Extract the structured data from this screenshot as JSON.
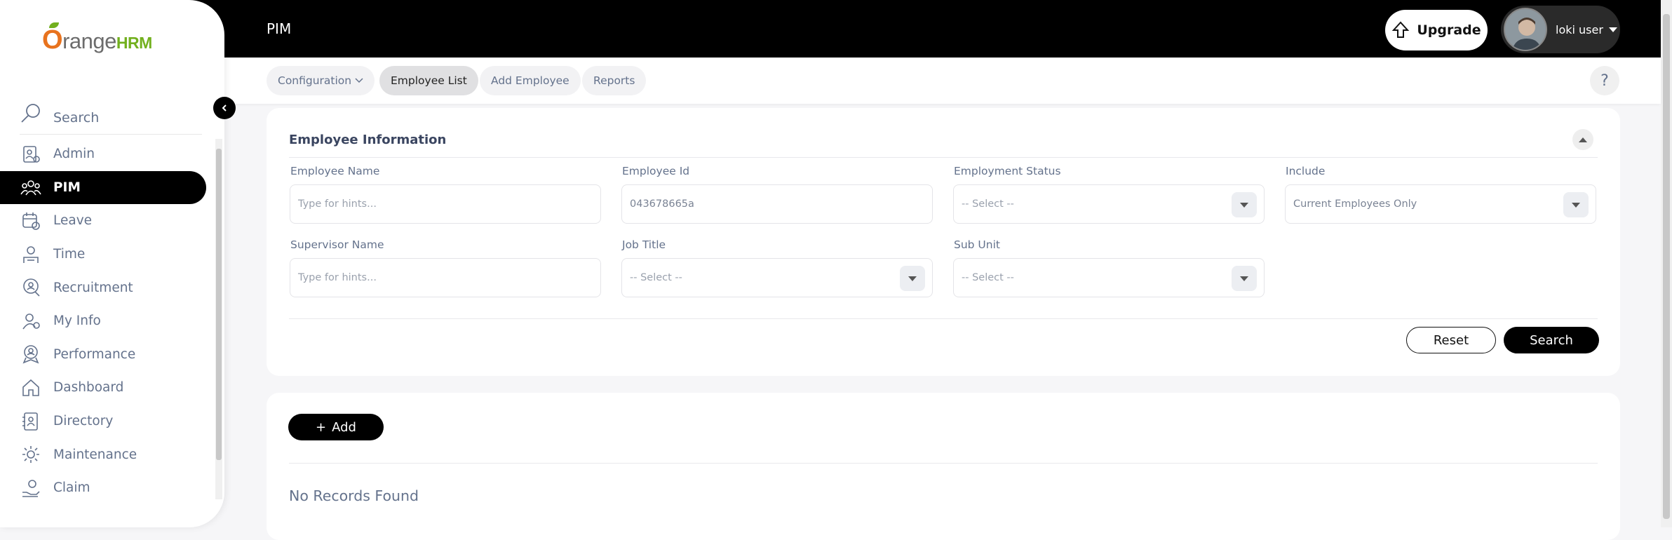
{
  "topbar": {
    "title": "PIM",
    "upgrade_label": "Upgrade",
    "user_name": "loki user"
  },
  "sidebar": {
    "search_label": "Search",
    "items": [
      {
        "label": "Admin",
        "icon": "admin-icon"
      },
      {
        "label": "PIM",
        "icon": "pim-icon",
        "active": true
      },
      {
        "label": "Leave",
        "icon": "leave-icon"
      },
      {
        "label": "Time",
        "icon": "time-icon"
      },
      {
        "label": "Recruitment",
        "icon": "recruitment-icon"
      },
      {
        "label": "My Info",
        "icon": "my-info-icon"
      },
      {
        "label": "Performance",
        "icon": "performance-icon"
      },
      {
        "label": "Dashboard",
        "icon": "dashboard-icon"
      },
      {
        "label": "Directory",
        "icon": "directory-icon"
      },
      {
        "label": "Maintenance",
        "icon": "maintenance-icon"
      },
      {
        "label": "Claim",
        "icon": "claim-icon"
      }
    ]
  },
  "subnav": {
    "tabs": [
      {
        "label": "Configuration"
      },
      {
        "label": "Employee List"
      },
      {
        "label": "Add Employee"
      },
      {
        "label": "Reports"
      }
    ],
    "help_label": "?"
  },
  "filter": {
    "title": "Employee Information",
    "employee_name": {
      "label": "Employee Name",
      "placeholder": "Type for hints..."
    },
    "employee_id": {
      "label": "Employee Id",
      "value": "043678665a"
    },
    "employment_status": {
      "label": "Employment Status",
      "value": "-- Select --"
    },
    "include": {
      "label": "Include",
      "value": "Current Employees Only"
    },
    "supervisor_name": {
      "label": "Supervisor Name",
      "placeholder": "Type for hints..."
    },
    "job_title": {
      "label": "Job Title",
      "value": "-- Select --"
    },
    "sub_unit": {
      "label": "Sub Unit",
      "value": "-- Select --"
    },
    "reset_label": "Reset",
    "search_label": "Search"
  },
  "results": {
    "add_label": "Add",
    "add_prefix": "+",
    "empty_text": "No Records Found"
  },
  "colors": {
    "topbar": "#000000",
    "accent": "#000000",
    "text": "#64728c"
  }
}
